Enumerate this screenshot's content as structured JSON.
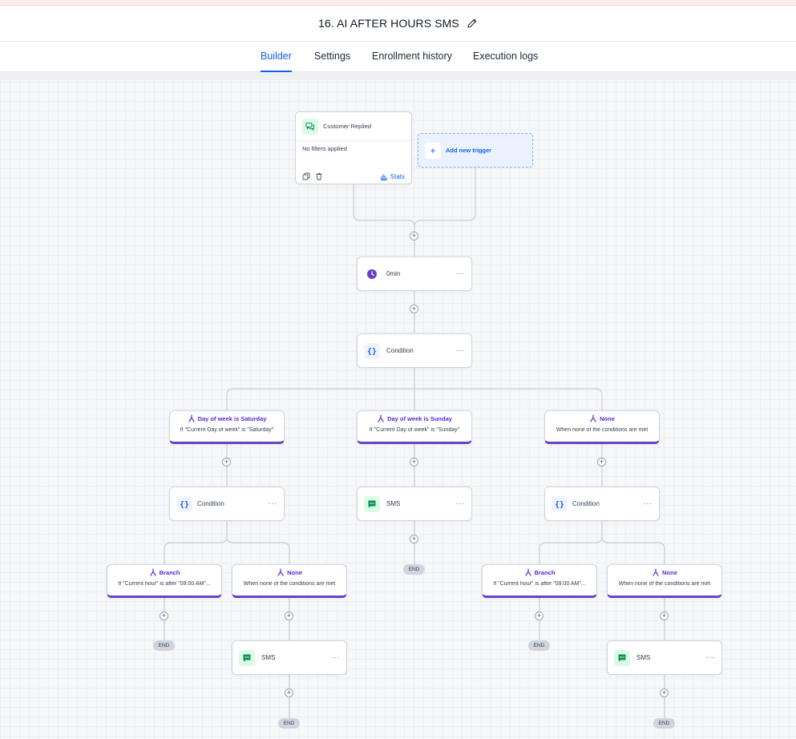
{
  "header": {
    "title": "16. AI AFTER HOURS SMS",
    "edit_icon": "pencil-icon"
  },
  "tabs": [
    {
      "label": "Builder",
      "active": true
    },
    {
      "label": "Settings",
      "active": false
    },
    {
      "label": "Enrollment history",
      "active": false
    },
    {
      "label": "Execution logs",
      "active": false
    }
  ],
  "trigger": {
    "name": "Customer Replied",
    "filters": "No filters applied",
    "stats_label": "Stats",
    "icon": "chat-bubbles-icon"
  },
  "add_trigger": {
    "label": "Add new trigger"
  },
  "steps": {
    "wait": {
      "label": "0min",
      "icon": "clock-icon"
    },
    "condition_main": {
      "label": "Condition",
      "icon": "braces-icon"
    }
  },
  "branches": {
    "saturday": {
      "title": "Day of week is Saturday",
      "desc": "If \"Current Day of week\" is \"Saturday\""
    },
    "sunday": {
      "title": "Day of week is Sunday",
      "desc": "If \"Current Day of week\" is \"Sunday\""
    },
    "none_main": {
      "title": "None",
      "desc": "When none of the conditions are met"
    },
    "left_branch": {
      "title": "Branch",
      "desc": "If \"Current hour\" is after \"09:00 AM\"..."
    },
    "left_none": {
      "title": "None",
      "desc": "When none of the conditions are met"
    },
    "right_branch": {
      "title": "Branch",
      "desc": "If \"Current hour\" is after \"09:00 AM\"..."
    },
    "right_none": {
      "title": "None",
      "desc": "When none of the conditions are met"
    }
  },
  "nodes": {
    "condition_left": {
      "label": "Condition"
    },
    "sms_sunday": {
      "label": "SMS"
    },
    "condition_right": {
      "label": "Condition"
    },
    "sms_left": {
      "label": "SMS"
    },
    "sms_right": {
      "label": "SMS"
    }
  },
  "labels": {
    "more": "···",
    "plus": "+",
    "end": "END"
  },
  "colors": {
    "accent": "#155eef",
    "branch": "#6941c6",
    "sms": "#12b76a",
    "clock": "#6941c6"
  }
}
